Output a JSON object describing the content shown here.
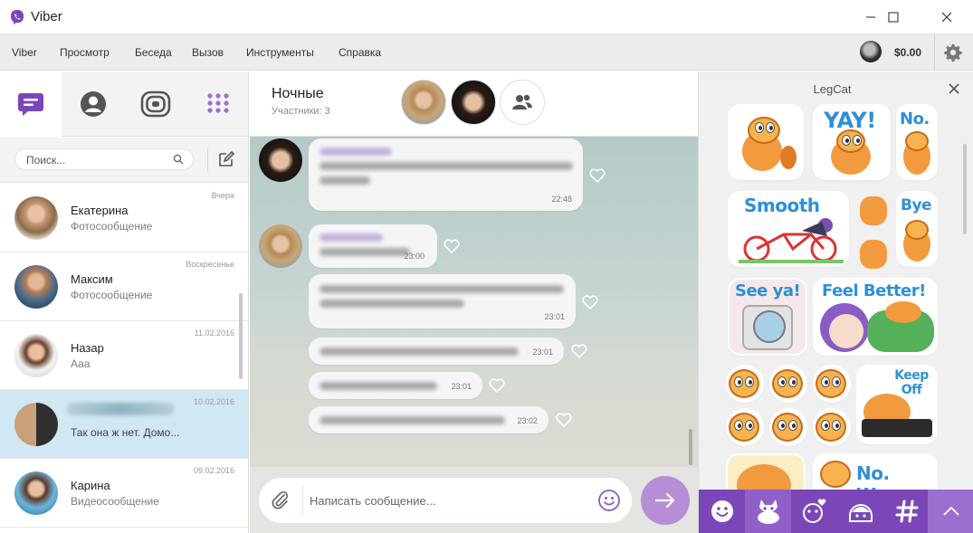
{
  "window": {
    "title": "Viber",
    "minimize_icon": "minimize-icon",
    "maximize_icon": "maximize-icon",
    "close_icon": "close-icon"
  },
  "menu": {
    "items": [
      "Viber",
      "Просмотр",
      "Беседа",
      "Вызов",
      "Инструменты",
      "Справка"
    ],
    "balance": "$0.00"
  },
  "sidebar": {
    "tabs": [
      {
        "icon": "chats-icon",
        "active": true
      },
      {
        "icon": "contacts-icon",
        "active": false
      },
      {
        "icon": "public-accounts-icon",
        "active": false
      },
      {
        "icon": "dialpad-icon",
        "active": false
      }
    ],
    "search_placeholder": "Поиск...",
    "chats": [
      {
        "name": "Екатерина",
        "preview": "Фотосообщение",
        "date": "Вчера"
      },
      {
        "name": "Максим",
        "preview": "Фотосообщение",
        "date": "Воскресенье"
      },
      {
        "name": "Назар",
        "preview": "Ааа",
        "date": "11.02.2016"
      },
      {
        "name": "",
        "preview": "Так она ж нет. Домо...",
        "date": "10.02.2016",
        "active": true
      },
      {
        "name": "Карина",
        "preview": "Видеосообщение",
        "date": "09.02.2016"
      }
    ]
  },
  "chat": {
    "title": "Ночные",
    "subtitle": "Участники: 3",
    "messages": [
      {
        "time": "22:48"
      },
      {
        "time": "23:00"
      },
      {
        "time": "23:01"
      },
      {
        "time": "23:01"
      },
      {
        "time": "23:01"
      },
      {
        "time": "23:02"
      }
    ],
    "input_placeholder": "Написать сообщение..."
  },
  "sticker_panel": {
    "pack_name": "LegCat",
    "labels": {
      "yay": "YAY!",
      "no": "No.",
      "smooth": "Smooth",
      "bye": "Bye",
      "see_ya": "See ya!",
      "feel_better": "Feel Better!",
      "keep_off": "Keep Off",
      "no_way": "No. Way."
    },
    "bar_icons": [
      "emoticons-icon",
      "sticker-cat-icon",
      "sticker-hearts-icon",
      "sticker-girl-icon",
      "hashtag-icon",
      "chevron-up-icon"
    ]
  },
  "colors": {
    "accent": "#7b47b8",
    "send_button": "#b58ed6",
    "active_chat": "#cfe8f3"
  }
}
